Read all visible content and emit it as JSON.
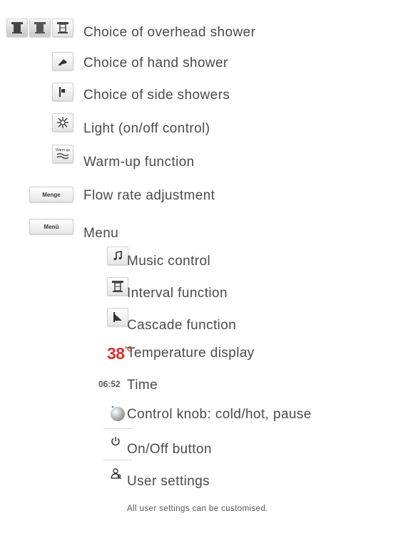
{
  "items": [
    {
      "label": "Choice of overhead shower",
      "icon": "overhead-shower-icon"
    },
    {
      "label": "Choice of hand shower",
      "icon": "hand-shower-icon"
    },
    {
      "label": "Choice of side showers",
      "icon": "side-shower-icon"
    },
    {
      "label": "Light (on/off control)",
      "icon": "light-icon"
    },
    {
      "label": "Warm-up function",
      "icon": "warm-up-icon"
    },
    {
      "label": "Flow rate adjustment",
      "button": "Menge"
    },
    {
      "label": "Menu",
      "button": "Menü"
    },
    {
      "label": "Music control",
      "icon": "music-icon"
    },
    {
      "label": "Interval function",
      "icon": "interval-icon"
    },
    {
      "label": "Cascade function",
      "icon": "cascade-icon"
    },
    {
      "label": "Temperature display",
      "value": "38",
      "unit": "°C"
    },
    {
      "label": "Time",
      "value": "06:52"
    },
    {
      "label": "Control knob: cold/hot, pause",
      "icon": "control-knob-icon"
    },
    {
      "label": "On/Off button",
      "icon": "power-icon"
    },
    {
      "label": "User settings",
      "icon": "user-settings-icon"
    }
  ],
  "warmup_button_text": "Warm up",
  "note": "All user settings can be customised.",
  "colors": {
    "temperature": "#d8322b",
    "text": "#4a4a4a"
  }
}
